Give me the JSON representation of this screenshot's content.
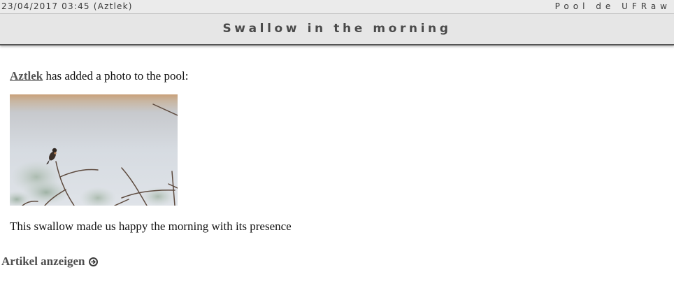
{
  "header": {
    "meta": "23/04/2017 03:45 (Aztlek)",
    "feed_name": "Pool de UFRaw"
  },
  "post": {
    "title": "Swallow in the morning",
    "author": "Aztlek",
    "action_text": "has added a photo to the pool:",
    "caption": "This swallow made us happy the morning with its presence"
  },
  "photo": {
    "icon": "swallow-photo"
  },
  "footer": {
    "more_label": "Artikel anzeigen",
    "more_icon": "circle-arrow-right-icon"
  }
}
